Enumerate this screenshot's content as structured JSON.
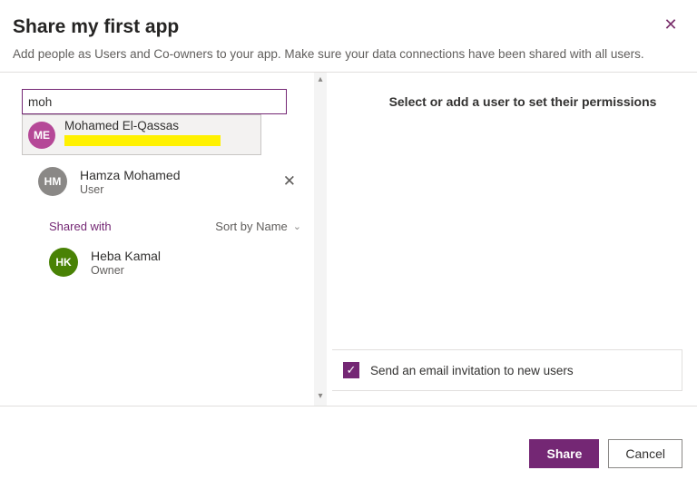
{
  "header": {
    "title": "Share my first app",
    "subtitle": "Add people as Users and Co-owners to your app. Make sure your data connections have been shared with all users."
  },
  "search": {
    "value": "moh"
  },
  "suggestion": {
    "initials": "ME",
    "name": "Mohamed El-Qassas"
  },
  "pending": {
    "initials": "HM",
    "name": "Hamza Mohamed",
    "role": "User"
  },
  "shared": {
    "label": "Shared with",
    "sort_label": "Sort by Name"
  },
  "owner": {
    "initials": "HK",
    "name": "Heba Kamal",
    "role": "Owner"
  },
  "right": {
    "message": "Select or add a user to set their permissions"
  },
  "email_invite": {
    "label": "Send an email invitation to new users",
    "checked": true
  },
  "buttons": {
    "share": "Share",
    "cancel": "Cancel"
  }
}
